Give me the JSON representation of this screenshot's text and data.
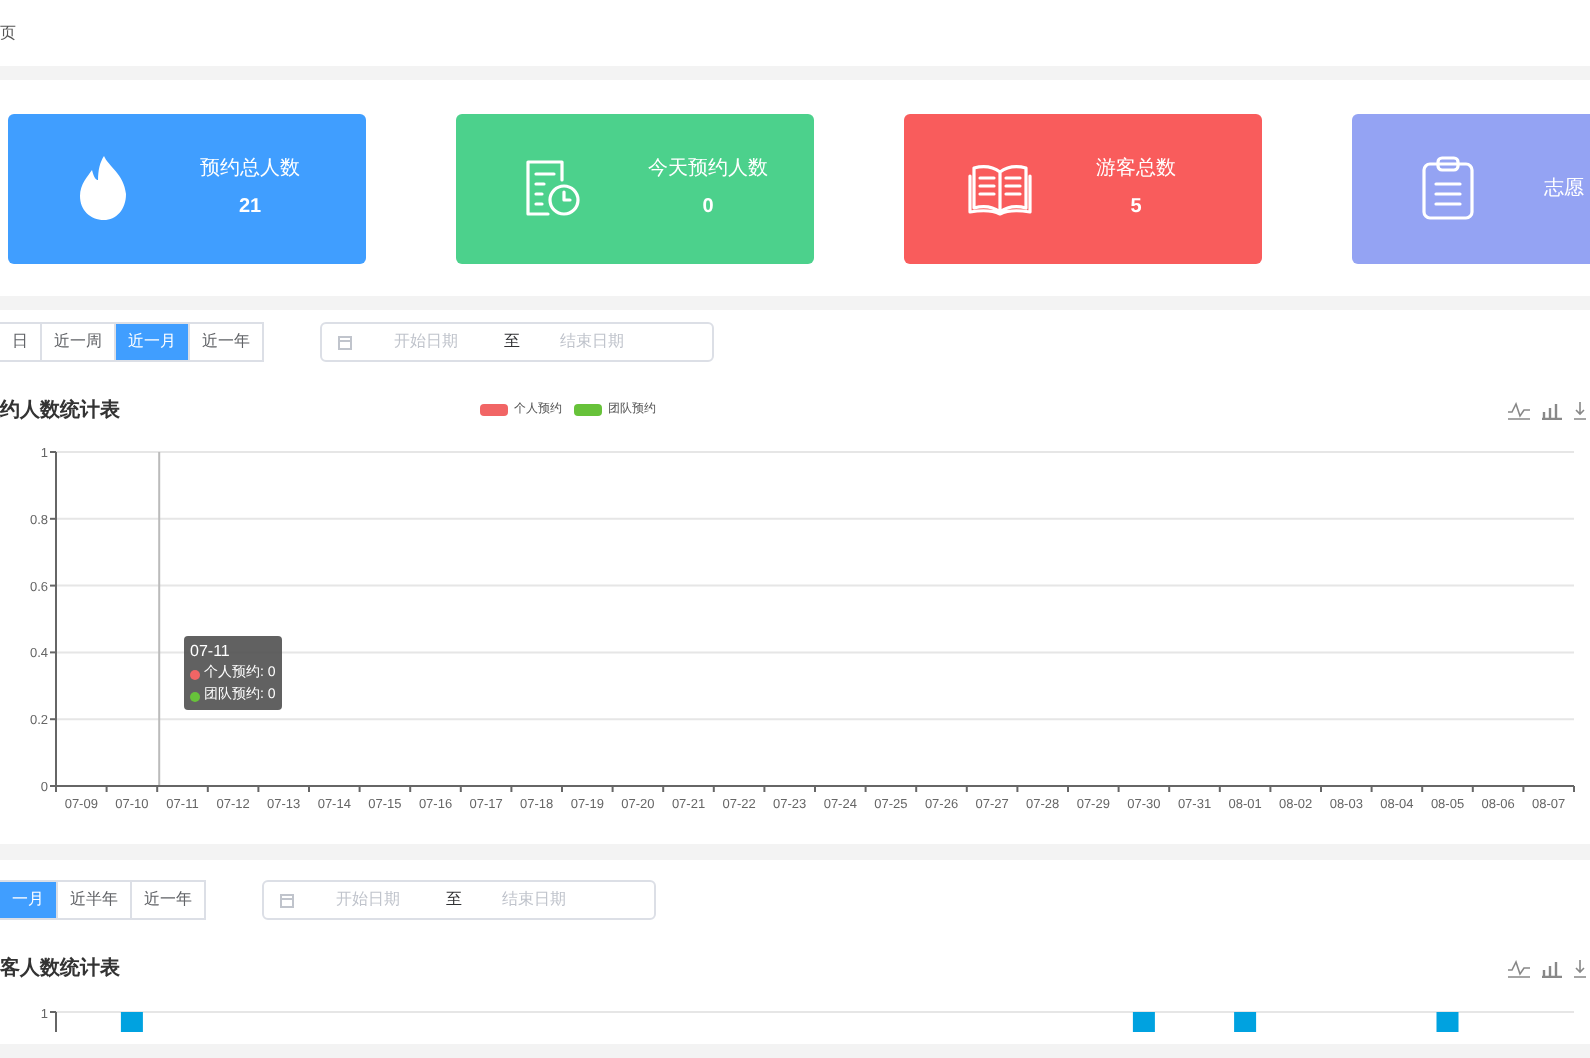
{
  "breadcrumb": "页",
  "cards": [
    {
      "kind": "hot",
      "label": "预约总人数",
      "value": "21",
      "color": "#409eff"
    },
    {
      "kind": "doc-clock",
      "label": "今天预约人数",
      "value": "0",
      "color": "#4cd18c"
    },
    {
      "kind": "book",
      "label": "游客总数",
      "value": "5",
      "color": "#f95c5c"
    },
    {
      "kind": "clipboard",
      "label": "志愿",
      "color": "#94a3f3"
    }
  ],
  "reservation_panel": {
    "ranges": [
      {
        "label": "日",
        "selected": false
      },
      {
        "label": "近一周",
        "selected": false
      },
      {
        "label": "近一月",
        "selected": true
      },
      {
        "label": "近一年",
        "selected": false
      }
    ],
    "date_range": {
      "start_placeholder": "开始日期",
      "separator": "至",
      "end_placeholder": "结束日期"
    },
    "title": "约人数统计表",
    "tooltip": {
      "title": "07-11",
      "lines": [
        {
          "text": "个人预约: 0",
          "color": "#f16565"
        },
        {
          "text": "团队预约: 0",
          "color": "#67c23a"
        }
      ]
    },
    "chart_data": {
      "type": "line",
      "categories": [
        "07-09",
        "07-10",
        "07-11",
        "07-12",
        "07-13",
        "07-14",
        "07-15",
        "07-16",
        "07-17",
        "07-18",
        "07-19",
        "07-20",
        "07-21",
        "07-22",
        "07-23",
        "07-24",
        "07-25",
        "07-26",
        "07-27",
        "07-28",
        "07-29",
        "07-30",
        "07-31",
        "08-01",
        "08-02",
        "08-03",
        "08-04",
        "08-05",
        "08-06",
        "08-07"
      ],
      "series": [
        {
          "name": "个人预约",
          "color": "#f16565",
          "values": [
            null,
            null,
            null,
            null,
            null,
            null,
            null,
            null,
            null,
            null,
            null,
            null,
            null,
            null,
            null,
            null,
            null,
            null,
            null,
            null,
            null,
            null,
            null,
            null,
            null,
            null,
            null,
            null,
            null,
            null
          ]
        },
        {
          "name": "团队预约",
          "color": "#67c23a",
          "values": [
            null,
            null,
            null,
            null,
            null,
            null,
            null,
            null,
            null,
            null,
            null,
            null,
            null,
            null,
            null,
            null,
            null,
            null,
            null,
            null,
            null,
            null,
            null,
            null,
            null,
            null,
            null,
            null,
            null,
            null
          ]
        }
      ],
      "grid": true,
      "ref_lines": [
        {
          "axis": "x",
          "value": "07-11",
          "color": "#bbbbbb"
        }
      ],
      "ylim": [
        0,
        1
      ],
      "yticks": [
        {
          "value": 0,
          "label": "0"
        },
        {
          "value": 0.2,
          "label": "0.2"
        },
        {
          "value": 0.4,
          "label": "0.4"
        },
        {
          "value": 0.6,
          "label": "0.6"
        },
        {
          "value": 0.8,
          "label": "0.8"
        },
        {
          "value": 1,
          "label": "1"
        }
      ]
    }
  },
  "visitor_panel": {
    "ranges": [
      {
        "label": "一月",
        "selected": true
      },
      {
        "label": "近半年",
        "selected": false
      },
      {
        "label": "近一年",
        "selected": false
      }
    ],
    "date_range": {
      "start_placeholder": "开始日期",
      "separator": "至",
      "end_placeholder": "结束日期"
    },
    "title": "客人数统计表",
    "axis_label": "1"
  }
}
